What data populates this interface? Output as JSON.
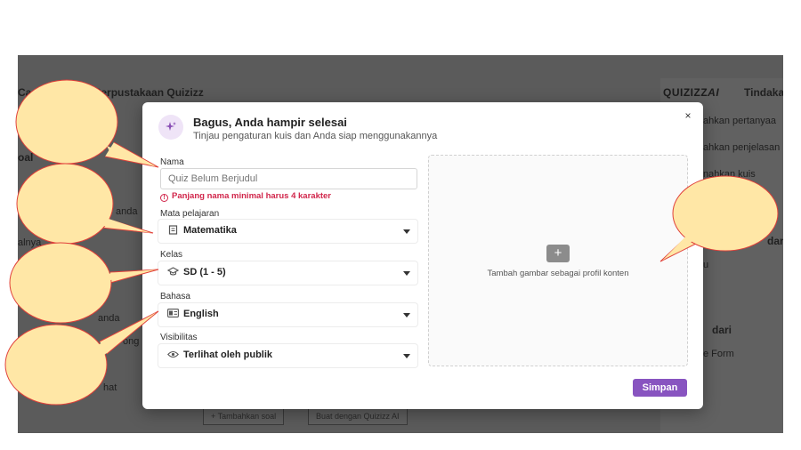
{
  "background": {
    "library_title": "dari Perpustakaan Quizizz",
    "library_prefix": "Ca",
    "brand": "QUIZIZZ",
    "brand_ai": "AI",
    "right_title": "Tindakan",
    "right_items": [
      "ahkan pertanyaa",
      "ahkan penjelasan",
      "nahkan kuis"
    ],
    "right_extra_1": "dan",
    "right_extra_2": "u",
    "right_extra_3": "dari",
    "right_extra_4": "e Form",
    "left_fragments": [
      "oal",
      "anda",
      "alnya",
      "anda",
      "ong",
      "hat"
    ],
    "bottom_buttons": [
      "+ Tambahkan soal",
      "Buat dengan Quizizz AI"
    ]
  },
  "modal": {
    "title": "Bagus, Anda hampir selesai",
    "subtitle": "Tinjau pengaturan kuis dan Anda siap menggunakannya",
    "close_label": "×",
    "name_label": "Nama",
    "name_placeholder": "Quiz Belum Berjudul",
    "name_error": "Panjang nama minimal harus 4 karakter",
    "subject_label": "Mata pelajaran",
    "subject_value": "Matematika",
    "grade_label": "Kelas",
    "grade_value": "SD (1 - 5)",
    "language_label": "Bahasa",
    "language_value": "English",
    "visibility_label": "Visibilitas",
    "visibility_value": "Terlihat oleh publik",
    "image_hint": "Tambah gambar sebagai profil konten",
    "add_image_symbol": "+",
    "save_label": "Simpan"
  },
  "colors": {
    "accent": "#8854c0",
    "error": "#d1264b",
    "callout_fill": "#ffe7a6",
    "callout_stroke": "#e0403a"
  }
}
